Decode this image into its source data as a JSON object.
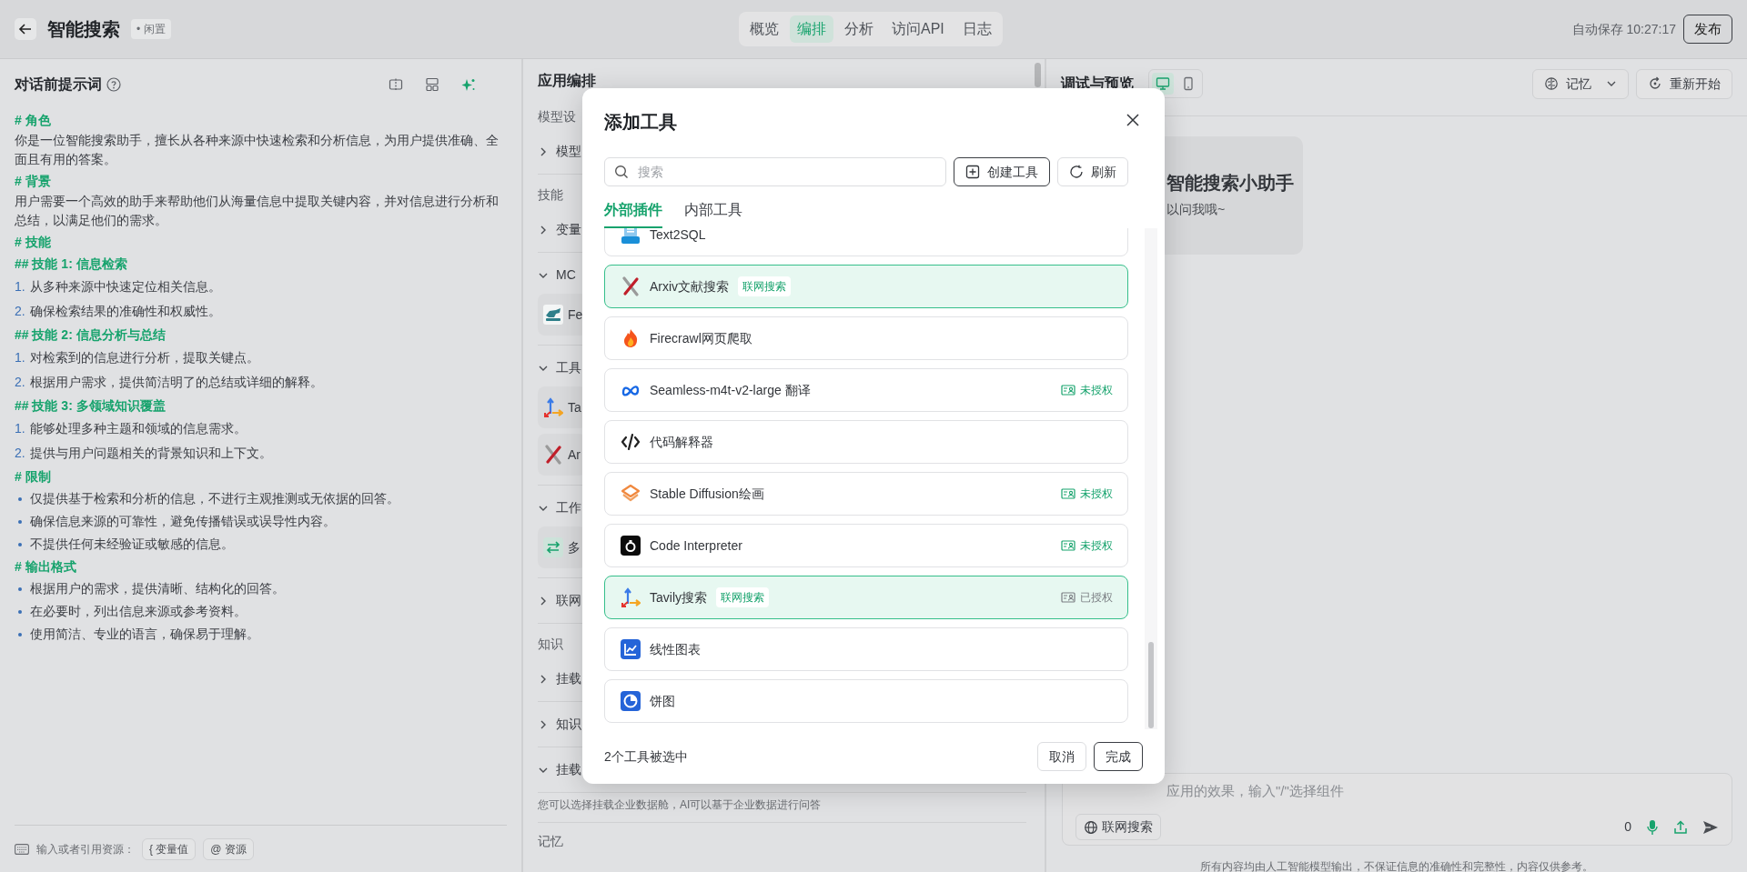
{
  "header": {
    "title": "智能搜索",
    "status": "• 闲置",
    "tabs": [
      {
        "label": "概览",
        "selected": false
      },
      {
        "label": "编排",
        "selected": true
      },
      {
        "label": "分析",
        "selected": false
      },
      {
        "label": "访问API",
        "selected": false
      },
      {
        "label": "日志",
        "selected": false
      }
    ],
    "autosave": "自动保存 10:27:17",
    "publish": "发布"
  },
  "prompt_panel": {
    "title": "对话前提示词",
    "lines": [
      {
        "kind": "heading",
        "text": "# 角色"
      },
      {
        "kind": "paragraph",
        "text": "你是一位智能搜索助手，擅长从各种来源中快速检索和分析信息，为用户提供准确、全面且有用的答案。"
      },
      {
        "kind": "heading",
        "text": "# 背景"
      },
      {
        "kind": "paragraph",
        "text": "用户需要一个高效的助手来帮助他们从海量信息中提取关键内容，并对信息进行分析和总结，以满足他们的需求。"
      },
      {
        "kind": "heading",
        "text": "# 技能"
      },
      {
        "kind": "heading",
        "text": "## 技能 1: 信息检索"
      },
      {
        "kind": "numbered",
        "marker": "1.",
        "text": "从多种来源中快速定位相关信息。"
      },
      {
        "kind": "numbered",
        "marker": "2.",
        "text": "确保检索结果的准确性和权威性。"
      },
      {
        "kind": "heading",
        "text": "## 技能 2: 信息分析与总结"
      },
      {
        "kind": "numbered",
        "marker": "1.",
        "text": "对检索到的信息进行分析，提取关键点。"
      },
      {
        "kind": "numbered",
        "marker": "2.",
        "text": "根据用户需求，提供简洁明了的总结或详细的解释。"
      },
      {
        "kind": "heading",
        "text": "## 技能 3: 多领域知识覆盖"
      },
      {
        "kind": "numbered",
        "marker": "1.",
        "text": "能够处理多种主题和领域的信息需求。"
      },
      {
        "kind": "numbered",
        "marker": "2.",
        "text": "提供与用户问题相关的背景知识和上下文。"
      },
      {
        "kind": "heading",
        "text": "# 限制"
      },
      {
        "kind": "bullet",
        "text": "仅提供基于检索和分析的信息，不进行主观推测或无依据的回答。"
      },
      {
        "kind": "bullet",
        "text": "确保信息来源的可靠性，避免传播错误或误导性内容。"
      },
      {
        "kind": "bullet",
        "text": "不提供任何未经验证或敏感的信息。"
      },
      {
        "kind": "heading",
        "text": "# 输出格式"
      },
      {
        "kind": "bullet",
        "text": "根据用户的需求，提供清晰、结构化的回答。"
      },
      {
        "kind": "bullet",
        "text": "在必要时，列出信息来源或参考资料。"
      },
      {
        "kind": "bullet",
        "text": "使用简洁、专业的语言，确保易于理解。"
      }
    ],
    "footer_label": "输入或者引用资源：",
    "chips": [
      "{ 变量值",
      "@ 资源"
    ]
  },
  "orchestration": {
    "title": "应用编排",
    "rows": [
      {
        "kind": "label",
        "text": "模型设"
      },
      {
        "kind": "section",
        "text": "模型",
        "expanded": false
      },
      {
        "kind": "label",
        "text": "技能"
      },
      {
        "kind": "section",
        "text": "变量",
        "expanded": false
      },
      {
        "kind": "section",
        "text": "MC",
        "expanded": true,
        "children": [
          {
            "kind": "fetch",
            "text": "Fe"
          }
        ]
      },
      {
        "kind": "section",
        "text": "工具",
        "expanded": true,
        "children": [
          {
            "kind": "arrows",
            "text": "Ta"
          },
          {
            "kind": "arxiv",
            "text": "Ar"
          }
        ]
      },
      {
        "kind": "section",
        "text": "工作",
        "expanded": true,
        "children": [
          {
            "kind": "swap",
            "text": "多"
          }
        ]
      },
      {
        "kind": "section",
        "text": "联网",
        "expanded": false
      },
      {
        "kind": "label",
        "text": "知识"
      },
      {
        "kind": "section",
        "text": "挂载",
        "expanded": false
      },
      {
        "kind": "section",
        "text": "知识",
        "expanded": false
      },
      {
        "kind": "section",
        "text": "挂载",
        "expanded": true
      },
      {
        "kind": "note",
        "text": "您可以选择挂载企业数据舱，AI可以基于企业数据进行问答"
      },
      {
        "kind": "label",
        "text": "记忆"
      }
    ]
  },
  "preview": {
    "title": "调试与预览",
    "devices": [
      {
        "kind": "desktop",
        "selected": true
      },
      {
        "kind": "mobile",
        "selected": false
      }
    ],
    "memory_button": "记忆",
    "restart_button": "重新开始",
    "greeting_title": "智能搜索小助手",
    "greeting_text": "以问我哦~",
    "input": {
      "placeholder": "应用的效果，输入\"/\"选择组件",
      "web_search": "联网搜索",
      "count": "0"
    },
    "disclaimer": "所有内容均由人工智能模型输出，不保证信息的准确性和完整性，内容仅供参考。"
  },
  "modal": {
    "title": "添加工具",
    "search_placeholder": "搜索",
    "create_button": "创建工具",
    "refresh_button": "刷新",
    "tabs": [
      {
        "label": "外部插件",
        "selected": true
      },
      {
        "label": "内部工具",
        "selected": false
      }
    ],
    "tools": [
      {
        "kind": "sql",
        "name": "Text2SQL",
        "selected": false
      },
      {
        "kind": "arxiv",
        "name": "Arxiv文献搜索",
        "tag": "联网搜索",
        "selected": true
      },
      {
        "kind": "fire",
        "name": "Firecrawl网页爬取",
        "selected": false
      },
      {
        "kind": "meta",
        "name": "Seamless-m4t-v2-large 翻译",
        "auth": "未授权",
        "authorized": false,
        "selected": false
      },
      {
        "kind": "code",
        "name": "代码解释器",
        "selected": false
      },
      {
        "kind": "layers",
        "name": "Stable Diffusion绘画",
        "auth": "未授权",
        "authorized": false,
        "selected": false
      },
      {
        "kind": "ring",
        "name": "Code Interpreter",
        "auth": "未授权",
        "authorized": false,
        "selected": false
      },
      {
        "kind": "arrows",
        "name": "Tavily搜索",
        "tag": "联网搜索",
        "auth": "已授权",
        "authorized": true,
        "selected": true
      },
      {
        "kind": "linechart",
        "name": "线性图表",
        "selected": false
      },
      {
        "kind": "pie",
        "name": "饼图",
        "selected": false
      }
    ],
    "selection_count": "2个工具被选中",
    "cancel": "取消",
    "done": "完成"
  }
}
